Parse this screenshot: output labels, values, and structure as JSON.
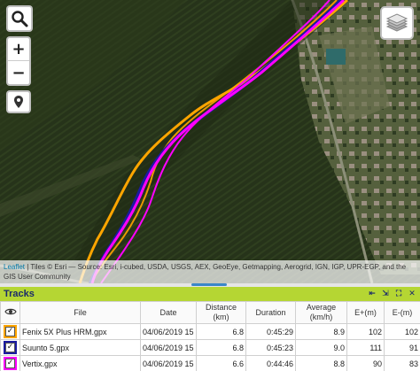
{
  "map": {
    "zoom_in_label": "+",
    "zoom_out_label": "−",
    "search_icon": "search-icon",
    "locate_icon": "location-pin-icon",
    "layers_icon": "layers-icon",
    "attribution": {
      "leaflet": "Leaflet",
      "text": " | Tiles © Esri — Source: Esri, i-cubed, USDA, USGS, AEX, GeoEye, Getmapping, Aerogrid, IGN, IGP, UPR-EGP, and the GIS User Community"
    },
    "track_colors": [
      "#ffa500",
      "#1a1aa0",
      "#ff00ff"
    ]
  },
  "panel": {
    "title": "Tracks",
    "tools": [
      "⇤",
      "⇲",
      "⛶",
      "✕"
    ]
  },
  "table": {
    "headers": {
      "eye": "👁",
      "file": "File",
      "date": "Date",
      "distance": "Distance (km)",
      "duration": "Duration",
      "average": "Average (km/h)",
      "eplus": "E+(m)",
      "eminus": "E-(m)"
    },
    "rows": [
      {
        "color": "#ffa500",
        "file": "Fenix 5X Plus HRM.gpx",
        "date": "04/06/2019 15",
        "distance": "6.8",
        "duration": "0:45:29",
        "average": "8.9",
        "eplus": "102",
        "eminus": "102"
      },
      {
        "color": "#1a1aa0",
        "file": "Suunto 5.gpx",
        "date": "04/06/2019 15",
        "distance": "6.8",
        "duration": "0:45:23",
        "average": "9.0",
        "eplus": "111",
        "eminus": "91"
      },
      {
        "color": "#ff00ff",
        "file": "Vertix.gpx",
        "date": "04/06/2019 15",
        "distance": "6.6",
        "duration": "0:44:46",
        "average": "8.8",
        "eplus": "90",
        "eminus": "83"
      }
    ]
  }
}
